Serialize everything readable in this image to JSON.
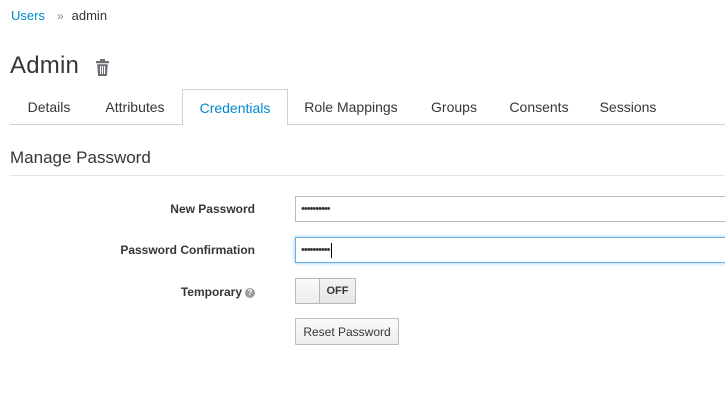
{
  "breadcrumb": {
    "link_label": "Users",
    "separator": "»",
    "current": "admin"
  },
  "page": {
    "title": "Admin",
    "delete_icon": "trash-icon"
  },
  "tabs": [
    {
      "label": "Details",
      "active": false
    },
    {
      "label": "Attributes",
      "active": false
    },
    {
      "label": "Credentials",
      "active": true
    },
    {
      "label": "Role Mappings",
      "active": false
    },
    {
      "label": "Groups",
      "active": false
    },
    {
      "label": "Consents",
      "active": false
    },
    {
      "label": "Sessions",
      "active": false
    }
  ],
  "section": {
    "title": "Manage Password"
  },
  "form": {
    "new_password": {
      "label": "New Password",
      "value": "••••••••••"
    },
    "confirm_password": {
      "label": "Password Confirmation",
      "value": "••••••••••"
    },
    "temporary": {
      "label": "Temporary",
      "help_icon": "question-circle-icon",
      "help_glyph": "?",
      "state": "OFF"
    },
    "reset_button": "Reset Password"
  },
  "colors": {
    "link": "#0088ce",
    "active_tab": "#0088ce",
    "focus_border": "#66afe9"
  }
}
